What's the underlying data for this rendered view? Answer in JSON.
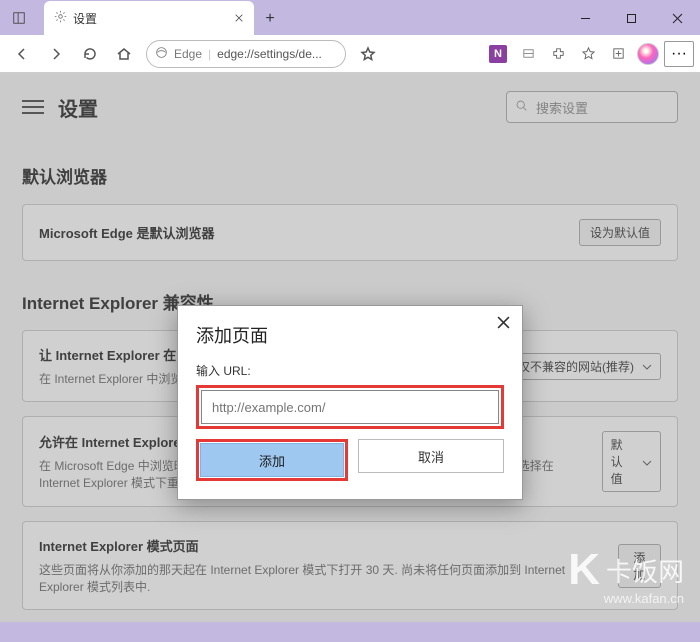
{
  "window": {
    "tab_title": "设置",
    "address_app": "Edge",
    "address_url": "edge://settings/de..."
  },
  "settings": {
    "page_title": "设置",
    "search_placeholder": "搜索设置",
    "section_default_browser": "默认浏览器",
    "default_browser_card": {
      "title": "Microsoft Edge 是默认浏览器",
      "button": "设为默认值"
    },
    "section_ie": "Internet Explorer 兼容性",
    "ie_compat_card": {
      "title": "让 Internet Explorer 在 Microsoft Edge 中打开网站",
      "desc": "在 Internet Explorer 中浏览时，可以选择在 Microsoft Edge 中自动打开网站",
      "dropdown": "仅不兼容的网站(推荐)"
    },
    "ie_reload_card": {
      "title": "允许在 Internet Explorer 模式下重新加载网站",
      "desc": "在 Microsoft Edge 中浏览时，如果某个网站因兼容问题需要使用 Internet Explorer，则可以选择在 Internet Explorer 模式下重新加载网站",
      "dropdown": "默认值"
    },
    "ie_pages_card": {
      "title": "Internet Explorer 模式页面",
      "desc": "这些页面将从你添加的那天起在 Internet Explorer 模式下打开 30 天. 尚未将任何页面添加到 Internet Explorer 模式列表中.",
      "button": "添加"
    }
  },
  "dialog": {
    "title": "添加页面",
    "label": "输入 URL:",
    "placeholder": "http://example.com/",
    "add": "添加",
    "cancel": "取消"
  },
  "watermark": {
    "brand": "卡饭网",
    "url": "www.kafan.cn"
  }
}
